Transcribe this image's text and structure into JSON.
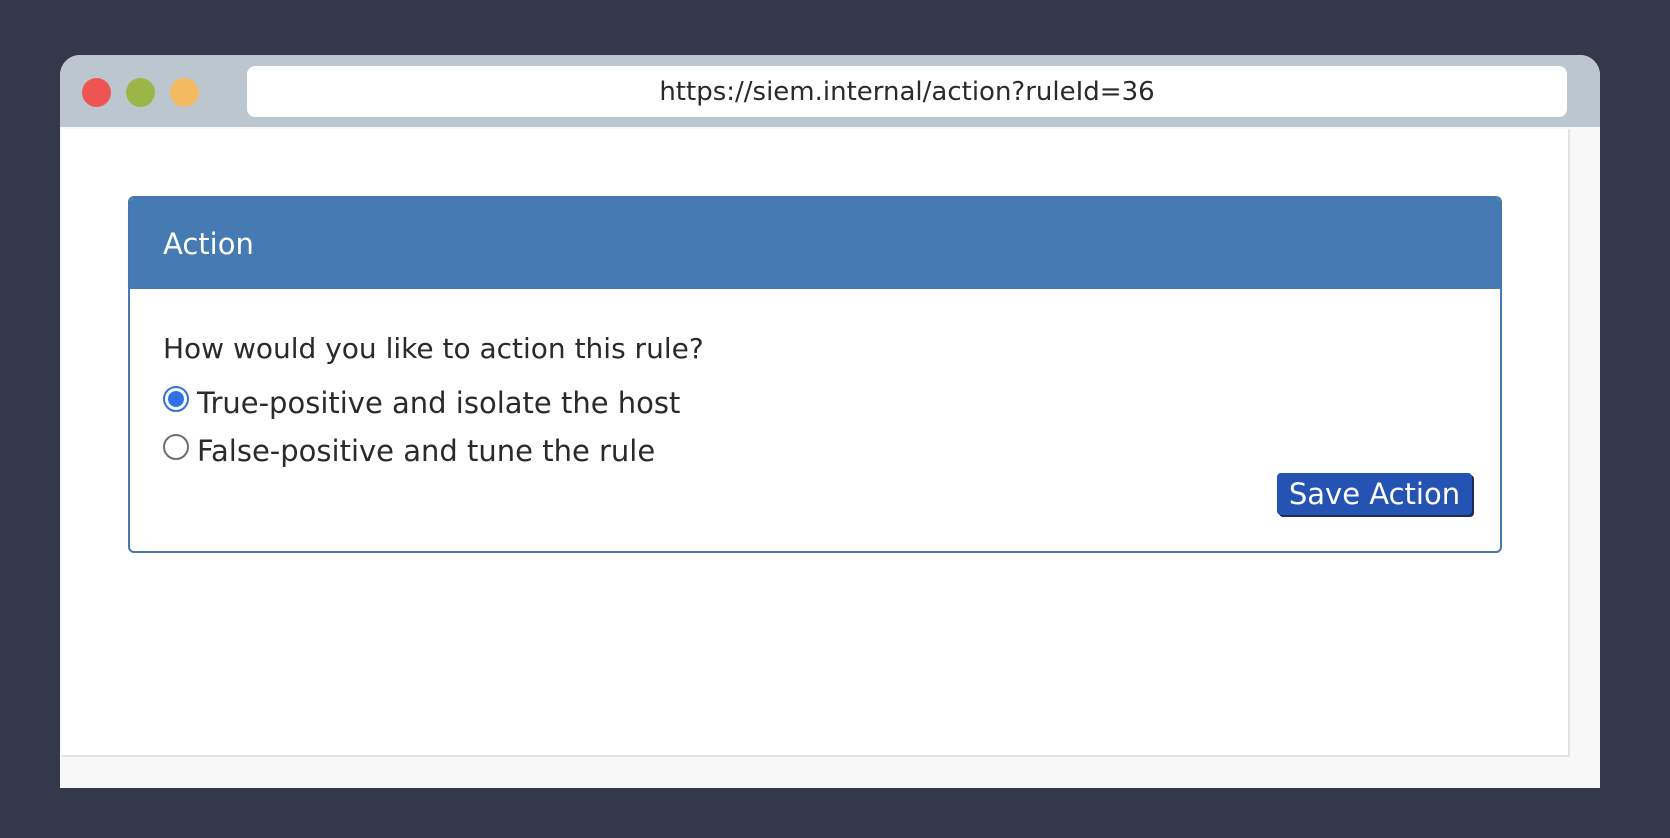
{
  "browser": {
    "url": "https://siem.internal/action?ruleId=36",
    "window_controls": [
      "close",
      "minimize",
      "maximize"
    ]
  },
  "panel": {
    "title": "Action",
    "question": "How would you like to action this rule?",
    "options": [
      {
        "label": "True-positive and isolate the host",
        "selected": true
      },
      {
        "label": "False-positive and tune the rule",
        "selected": false
      }
    ],
    "save_label": "Save Action"
  },
  "colors": {
    "background": "#33384b",
    "header": "#457ab2",
    "button": "#2453b3",
    "radio_accent": "#2f72e8"
  }
}
